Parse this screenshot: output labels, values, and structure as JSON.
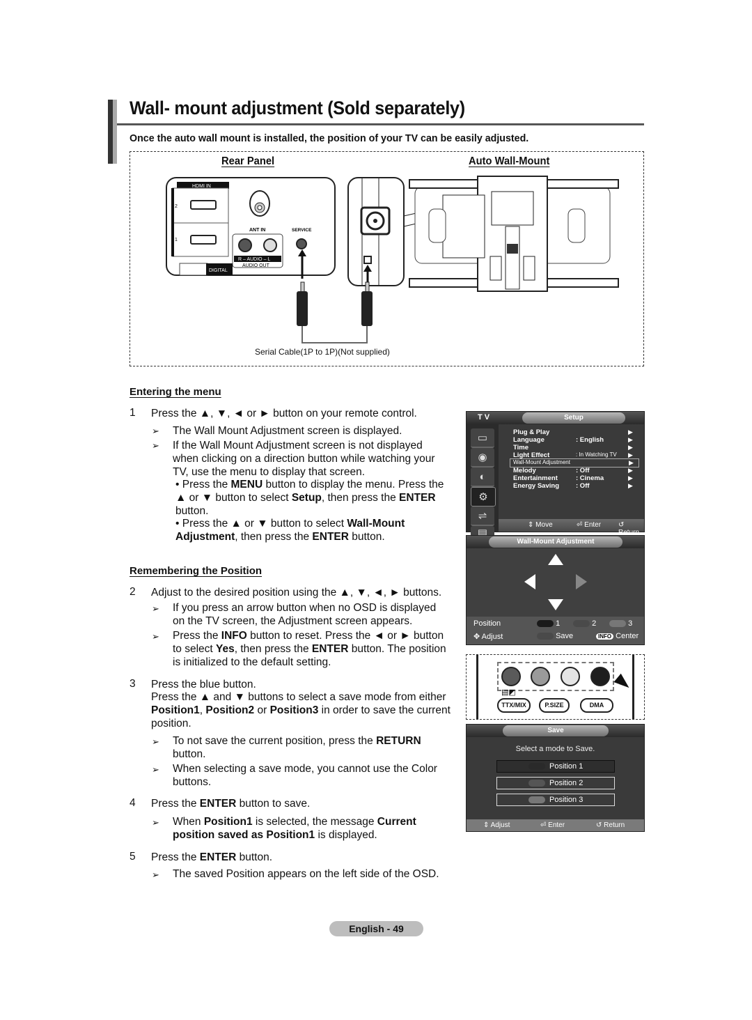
{
  "page": {
    "title": "Wall- mount adjustment (Sold separately)",
    "intro": "Once the auto wall mount is installed, the position of your TV can be easily adjusted.",
    "footer": "English - 49"
  },
  "diagram": {
    "rear_panel_label": "Rear Panel",
    "wall_mount_label": "Auto Wall-Mount",
    "rear_panel": {
      "hdmi_in": "HDMI IN",
      "hdmi_ports": [
        "2",
        "1"
      ],
      "ant_in": "ANT IN",
      "service": "SERVICE",
      "audio": "R - AUDIO - L",
      "audio_out": "AUDIO OUT",
      "digital": "DIGITAL"
    },
    "cable_caption": "Serial Cable(1P to 1P)(Not supplied)"
  },
  "sections": {
    "entering": {
      "heading": "Entering the menu",
      "step1": {
        "num": "1",
        "text": "Press the ▲, ▼, ◄ or ► button on your remote control.",
        "notes": [
          "The Wall Mount Adjustment screen is displayed.",
          "If the Wall Mount Adjustment screen is not displayed when clicking on a direction button while watching your TV, use the menu to display that screen."
        ],
        "bullets": [
          [
            "• Press the ",
            "MENU",
            " button to display the menu. Press the ▲ or ▼ button to select ",
            "Setup",
            ", then press the ",
            "ENTER",
            " button."
          ],
          [
            "• Press the ▲ or ▼ button to select ",
            "Wall-Mount Adjustment",
            ", then press the ",
            "ENTER",
            " button."
          ]
        ]
      }
    },
    "remembering": {
      "heading": "Remembering the Position",
      "step2": {
        "num": "2",
        "text": "Adjust to the desired position using the ▲, ▼, ◄, ► buttons.",
        "note1": "If you press an arrow button when no OSD is displayed on the TV screen, the Adjustment screen appears.",
        "note2": [
          "Press the ",
          "INFO",
          " button to reset. Press the ◄ or ► button to select ",
          "Yes",
          ", then press the ",
          "ENTER",
          " button. The position is initialized to the default setting."
        ]
      },
      "step3": {
        "num": "3",
        "line1": "Press the blue button.",
        "line2": [
          "Press the ▲ and ▼ buttons to select a save mode from either ",
          "Position1",
          ", ",
          "Position2",
          " or ",
          "Position3",
          " in order to save the current position."
        ],
        "note1": [
          "To not save the current position, press the ",
          "RETURN",
          " button."
        ],
        "note2": "When selecting a save mode, you cannot use the Color buttons."
      },
      "step4": {
        "num": "4",
        "text": [
          "Press the ",
          "ENTER",
          " button to save."
        ],
        "note": [
          "When ",
          "Position1",
          " is selected, the message ",
          "Current position saved as Position1",
          " is displayed."
        ]
      },
      "step5": {
        "num": "5",
        "text": [
          "Press the ",
          "ENTER",
          " button."
        ],
        "note": "The saved Position appears on the left side of the OSD."
      }
    }
  },
  "osd_setup": {
    "tv_label": "T V",
    "title": "Setup",
    "items": [
      {
        "label": "Plug & Play",
        "value": ""
      },
      {
        "label": "Language",
        "value": ": English"
      },
      {
        "label": "Time",
        "value": ""
      },
      {
        "label": "Light Effect",
        "value": ": In Watching TV"
      },
      {
        "label": "Wall-Mount Adjustment",
        "value": "",
        "selected": true
      },
      {
        "label": "Melody",
        "value": ": Off"
      },
      {
        "label": "Entertainment",
        "value": ": Cinema"
      },
      {
        "label": "Energy Saving",
        "value": ": Off"
      }
    ],
    "footer": {
      "move": "Move",
      "enter": "Enter",
      "return": "Return"
    }
  },
  "osd_adjust": {
    "title": "Wall-Mount Adjustment",
    "position_label": "Position",
    "positions": [
      "1",
      "2",
      "3"
    ],
    "adjust": "Adjust",
    "save": "Save",
    "info": "INFO",
    "center": "Center"
  },
  "remote": {
    "buttons": [
      "TTX/MIX",
      "P.SIZE",
      "DMA"
    ],
    "color_buttons": [
      "red",
      "green",
      "yellow",
      "blue"
    ],
    "colors": [
      "#5a5a5a",
      "#9a9a9a",
      "#e4e4e4",
      "#1e1e1e"
    ]
  },
  "osd_save": {
    "title": "Save",
    "prompt": "Select a mode to Save.",
    "options": [
      "Position 1",
      "Position 2",
      "Position 3"
    ],
    "footer": {
      "adjust": "Adjust",
      "enter": "Enter",
      "return": "Return"
    }
  }
}
